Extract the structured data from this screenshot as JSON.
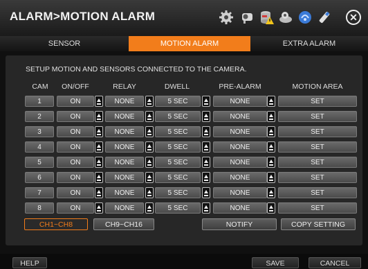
{
  "title": "ALARM>MOTION ALARM",
  "toolbar_icons": [
    "gear-icon",
    "camera-icon",
    "database-warning-icon",
    "record-icon",
    "network-icon",
    "usb-icon"
  ],
  "tabs": [
    {
      "label": "SENSOR",
      "active": false
    },
    {
      "label": "MOTION ALARM",
      "active": true
    },
    {
      "label": "EXTRA ALARM",
      "active": false
    }
  ],
  "description": "SETUP MOTION AND SENSORS CONNECTED TO THE CAMERA.",
  "columns": [
    "CAM",
    "ON/OFF",
    "RELAY",
    "DWELL",
    "PRE-ALARM",
    "MOTION AREA"
  ],
  "rows": [
    {
      "cam": "1",
      "onoff": "ON",
      "relay": "NONE",
      "dwell": "5 SEC",
      "prealarm": "NONE",
      "area": "SET"
    },
    {
      "cam": "2",
      "onoff": "ON",
      "relay": "NONE",
      "dwell": "5 SEC",
      "prealarm": "NONE",
      "area": "SET"
    },
    {
      "cam": "3",
      "onoff": "ON",
      "relay": "NONE",
      "dwell": "5 SEC",
      "prealarm": "NONE",
      "area": "SET"
    },
    {
      "cam": "4",
      "onoff": "ON",
      "relay": "NONE",
      "dwell": "5 SEC",
      "prealarm": "NONE",
      "area": "SET"
    },
    {
      "cam": "5",
      "onoff": "ON",
      "relay": "NONE",
      "dwell": "5 SEC",
      "prealarm": "NONE",
      "area": "SET"
    },
    {
      "cam": "6",
      "onoff": "ON",
      "relay": "NONE",
      "dwell": "5 SEC",
      "prealarm": "NONE",
      "area": "SET"
    },
    {
      "cam": "7",
      "onoff": "ON",
      "relay": "NONE",
      "dwell": "5 SEC",
      "prealarm": "NONE",
      "area": "SET"
    },
    {
      "cam": "8",
      "onoff": "ON",
      "relay": "NONE",
      "dwell": "5 SEC",
      "prealarm": "NONE",
      "area": "SET"
    }
  ],
  "buttons": {
    "ch1_8": "CH1~CH8",
    "ch9_16": "CH9~CH16",
    "notify": "NOTIFY",
    "copy_setting": "COPY SETTING"
  },
  "footer": {
    "help": "HELP",
    "save": "SAVE",
    "cancel": "CANCEL"
  },
  "colors": {
    "accent": "#f27d1b"
  }
}
